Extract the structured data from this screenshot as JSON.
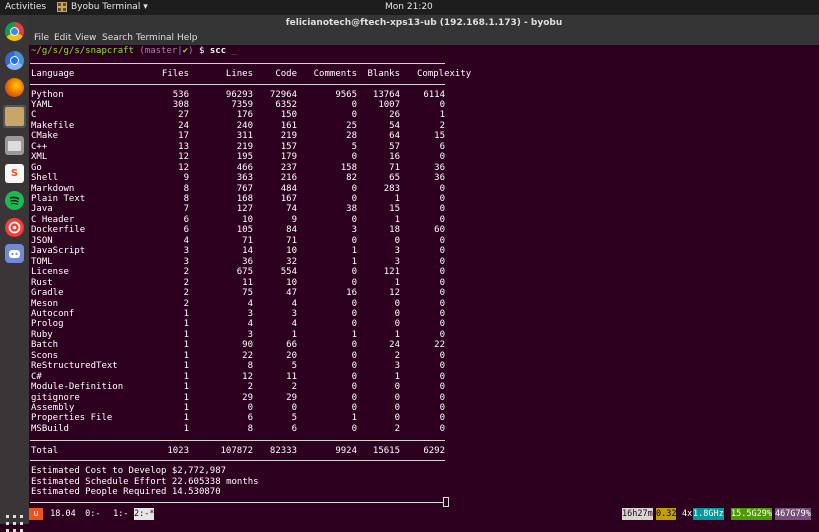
{
  "topbar": {
    "activities": "Activities",
    "app_name": "Byobu Terminal",
    "app_arrow": "▾",
    "clock": "Mon 21:20"
  },
  "dock": {
    "items": [
      {
        "name": "chrome",
        "color": "#e34133",
        "glyph": ""
      },
      {
        "name": "chromium",
        "color": "#3b7fd6",
        "glyph": ""
      },
      {
        "name": "firefox",
        "color": "#e66000",
        "glyph": ""
      },
      {
        "name": "byobu",
        "color": "#caa56a",
        "glyph": ""
      },
      {
        "name": "files",
        "color": "#8b8b8b",
        "glyph": ""
      },
      {
        "name": "snapcraft",
        "color": "#ffffff",
        "glyph": "S"
      },
      {
        "name": "spotify",
        "color": "#1db954",
        "glyph": ""
      },
      {
        "name": "pocket-casts",
        "color": "#f43e37",
        "glyph": ""
      },
      {
        "name": "discord",
        "color": "#7289da",
        "glyph": ""
      }
    ]
  },
  "window": {
    "title": "felicianotech@ftech-xps13-ub (192.168.1.173) - byobu",
    "menu": [
      "File",
      "Edit",
      "View",
      "Search",
      "Terminal",
      "Help"
    ]
  },
  "prompt": {
    "path": "~/g/s/g/s/snapcraft",
    "branch": " (master|",
    "check": "✔",
    "close": ")",
    "dollar": " $ ",
    "command": "scc",
    "cursor": " _"
  },
  "table": {
    "headers": [
      "Language",
      "Files",
      "Lines",
      "Code",
      "Comments",
      "Blanks",
      "Complexity"
    ],
    "rows": [
      [
        "Python",
        "536",
        "96293",
        "72964",
        "9565",
        "13764",
        "6114"
      ],
      [
        "YAML",
        "308",
        "7359",
        "6352",
        "0",
        "1007",
        "0"
      ],
      [
        "C",
        "27",
        "176",
        "150",
        "0",
        "26",
        "1"
      ],
      [
        "Makefile",
        "24",
        "240",
        "161",
        "25",
        "54",
        "2"
      ],
      [
        "CMake",
        "17",
        "311",
        "219",
        "28",
        "64",
        "15"
      ],
      [
        "C++",
        "13",
        "219",
        "157",
        "5",
        "57",
        "6"
      ],
      [
        "XML",
        "12",
        "195",
        "179",
        "0",
        "16",
        "0"
      ],
      [
        "Go",
        "12",
        "466",
        "237",
        "158",
        "71",
        "36"
      ],
      [
        "Shell",
        "9",
        "363",
        "216",
        "82",
        "65",
        "36"
      ],
      [
        "Markdown",
        "8",
        "767",
        "484",
        "0",
        "283",
        "0"
      ],
      [
        "Plain Text",
        "8",
        "168",
        "167",
        "0",
        "1",
        "0"
      ],
      [
        "Java",
        "7",
        "127",
        "74",
        "38",
        "15",
        "0"
      ],
      [
        "C Header",
        "6",
        "10",
        "9",
        "0",
        "1",
        "0"
      ],
      [
        "Dockerfile",
        "6",
        "105",
        "84",
        "3",
        "18",
        "60"
      ],
      [
        "JSON",
        "4",
        "71",
        "71",
        "0",
        "0",
        "0"
      ],
      [
        "JavaScript",
        "3",
        "14",
        "10",
        "1",
        "3",
        "0"
      ],
      [
        "TOML",
        "3",
        "36",
        "32",
        "1",
        "3",
        "0"
      ],
      [
        "License",
        "2",
        "675",
        "554",
        "0",
        "121",
        "0"
      ],
      [
        "Rust",
        "2",
        "11",
        "10",
        "0",
        "1",
        "0"
      ],
      [
        "Gradle",
        "2",
        "75",
        "47",
        "16",
        "12",
        "0"
      ],
      [
        "Meson",
        "2",
        "4",
        "4",
        "0",
        "0",
        "0"
      ],
      [
        "Autoconf",
        "1",
        "3",
        "3",
        "0",
        "0",
        "0"
      ],
      [
        "Prolog",
        "1",
        "4",
        "4",
        "0",
        "0",
        "0"
      ],
      [
        "Ruby",
        "1",
        "3",
        "1",
        "1",
        "1",
        "0"
      ],
      [
        "Batch",
        "1",
        "90",
        "66",
        "0",
        "24",
        "22"
      ],
      [
        "Scons",
        "1",
        "22",
        "20",
        "0",
        "2",
        "0"
      ],
      [
        "ReStructuredText",
        "1",
        "8",
        "5",
        "0",
        "3",
        "0"
      ],
      [
        "C#",
        "1",
        "12",
        "11",
        "0",
        "1",
        "0"
      ],
      [
        "Module-Definition",
        "1",
        "2",
        "2",
        "0",
        "0",
        "0"
      ],
      [
        "gitignore",
        "1",
        "29",
        "29",
        "0",
        "0",
        "0"
      ],
      [
        "Assembly",
        "1",
        "0",
        "0",
        "0",
        "0",
        "0"
      ],
      [
        "Properties File",
        "1",
        "6",
        "5",
        "1",
        "0",
        "0"
      ],
      [
        "MSBuild",
        "1",
        "8",
        "6",
        "0",
        "2",
        "0"
      ]
    ],
    "total": [
      "Total",
      "1023",
      "107872",
      "82333",
      "9924",
      "15615",
      "6292"
    ]
  },
  "estimates": [
    "Estimated Cost to Develop $2,772,987",
    "Estimated Schedule Effort 22.605338 months",
    "Estimated People Required 14.530870"
  ],
  "statusbar": {
    "logo": "u",
    "release": " 18.04",
    "win0": " 0:- ",
    "win1": " 1:- ",
    "win2": "2:-*",
    "uptime": "16h27m",
    "load": "0.32",
    "cpu": "4x",
    "freq": "1.8GHz",
    "mem": "15.5G29%",
    "disk": "467G79%"
  },
  "colors": {
    "terminal_bg": "#2c001e",
    "prompt_path": "#8ae234",
    "prompt_branch": "#ad7fa8",
    "status_logo": "#e95420",
    "status_load": "#c4a000",
    "status_freq": "#06989a",
    "status_mem": "#4e9a06",
    "status_disk": "#75507b"
  }
}
